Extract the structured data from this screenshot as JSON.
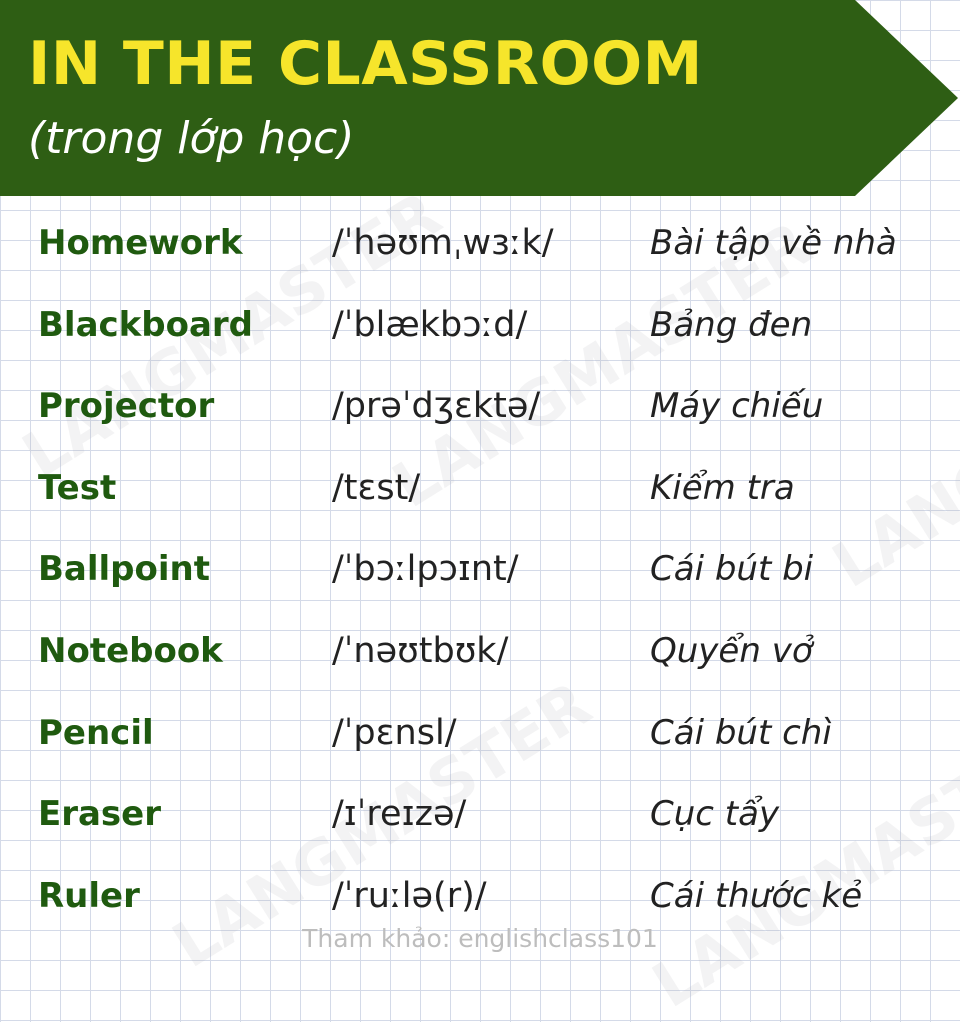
{
  "header": {
    "title": "IN THE CLASSROOM",
    "subtitle": "(trong lớp học)"
  },
  "vocabulary": [
    {
      "word": "Homework",
      "ipa": "/ˈhəʊmˌwɜːk/",
      "meaning": "Bài tập về nhà"
    },
    {
      "word": "Blackboard",
      "ipa": "/ˈblækbɔːd/",
      "meaning": "Bảng đen"
    },
    {
      "word": "Projector",
      "ipa": "/prəˈdʒɛktə/",
      "meaning": "Máy chiếu"
    },
    {
      "word": "Test",
      "ipa": "/tɛst/",
      "meaning": "Kiểm tra"
    },
    {
      "word": "Ballpoint",
      "ipa": "/ˈbɔːlpɔɪnt/",
      "meaning": "Cái bút bi"
    },
    {
      "word": "Notebook",
      "ipa": "/ˈnəʊtbʊk/",
      "meaning": "Quyển vở"
    },
    {
      "word": "Pencil",
      "ipa": "/ˈpɛnsl/",
      "meaning": "Cái bút chì"
    },
    {
      "word": "Eraser",
      "ipa": "/ɪˈreɪzə/",
      "meaning": "Cục tẩy"
    },
    {
      "word": "Ruler",
      "ipa": "/ˈruːlə(r)/",
      "meaning": "Cái thước kẻ"
    }
  ],
  "watermark": "LANGMASTER",
  "footer": "Tham khảo: englishclass101",
  "colors": {
    "banner": "#2e5e14",
    "title": "#f6e52b",
    "word": "#1f5a0f",
    "grid": "#d4dae8"
  }
}
